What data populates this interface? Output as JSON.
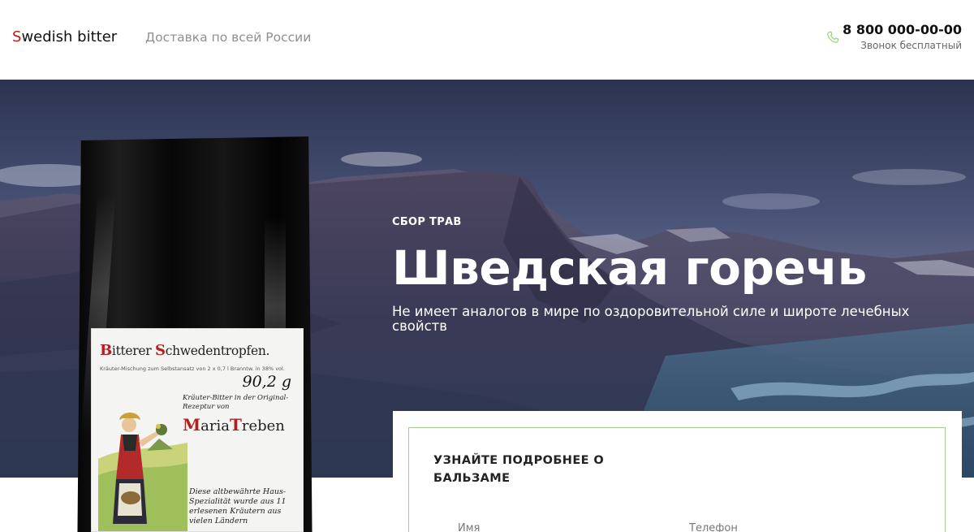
{
  "header": {
    "logo_first_letter": "S",
    "logo_rest": "wedish bitter",
    "delivery_text": "Доставка по всей России",
    "phone_icon": "phone-icon",
    "phone_number": "8 800 000-00-00",
    "phone_note": "Звонок бесплатный"
  },
  "hero": {
    "eyebrow": "СБОР ТРАВ",
    "title": "Шведская горечь",
    "subtitle": "Не имеет аналогов в мире по оздоровительной силе и широте лечебных свойств"
  },
  "product": {
    "label_title_b": "B",
    "label_title_mid": "itterer ",
    "label_title_s": "S",
    "label_title_end": "chwedentropfen.",
    "label_small": "Kräuter-Mischung zum Selbstansatz von 2 x 0,7 l Branntw. in 38% vol.",
    "label_weight": "90,2 g",
    "label_script1": "Kräuter-Bitter in der Original-Rezeptur von",
    "label_brand_m": "M",
    "label_brand_mid": "aria",
    "label_brand_t": "T",
    "label_brand_end": "reben",
    "label_script2": "Diese altbewährte Haus-Spezialität wurde aus 11 erlesenen Kräutern aus vielen Ländern"
  },
  "form": {
    "heading": "УЗНАЙТЕ ПОДРОБНЕЕ О БАЛЬЗАМЕ",
    "name_label": "Имя",
    "phone_label": "Телефон"
  },
  "colors": {
    "logo_accent": "#c21a1a",
    "phone_icon": "#9ccf7c",
    "form_border": "#a7cf93"
  }
}
